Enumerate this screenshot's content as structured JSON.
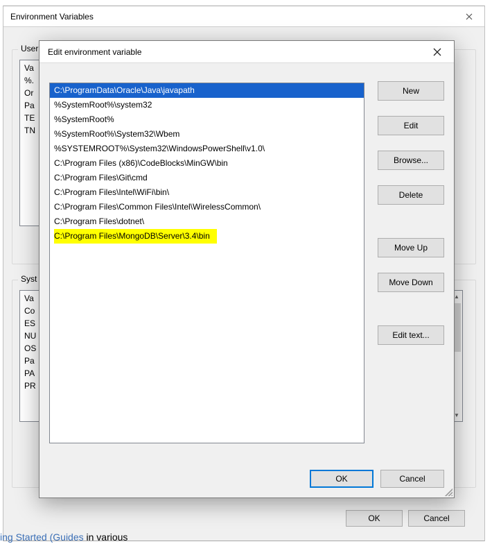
{
  "parent": {
    "title": "Environment Variables",
    "user_label_prefix": "User",
    "system_label_prefix": "Syst",
    "user_vars": [
      "Va",
      "%.",
      "Or",
      "Pa",
      "TE",
      "TN"
    ],
    "system_vars": [
      "Va",
      "Co",
      "ES",
      "NU",
      "OS",
      "Pa",
      "PA",
      "PR"
    ],
    "ok_label": "OK",
    "cancel_label": "Cancel"
  },
  "child": {
    "title": "Edit environment variable",
    "paths": [
      "C:\\ProgramData\\Oracle\\Java\\javapath",
      "%SystemRoot%\\system32",
      "%SystemRoot%",
      "%SystemRoot%\\System32\\Wbem",
      "%SYSTEMROOT%\\System32\\WindowsPowerShell\\v1.0\\",
      "C:\\Program Files (x86)\\CodeBlocks\\MinGW\\bin",
      "C:\\Program Files\\Git\\cmd",
      "C:\\Program Files\\Intel\\WiFi\\bin\\",
      "C:\\Program Files\\Common Files\\Intel\\WirelessCommon\\",
      "C:\\Program Files\\dotnet\\",
      "C:\\Program Files\\MongoDB\\Server\\3.4\\bin"
    ],
    "selected_index": 0,
    "highlighted_index": 10,
    "buttons": {
      "new": "New",
      "edit": "Edit",
      "browse": "Browse...",
      "delete": "Delete",
      "move_up": "Move Up",
      "move_down": "Move Down",
      "edit_text": "Edit text..."
    },
    "ok_label": "OK",
    "cancel_label": "Cancel"
  },
  "fragment": {
    "link": "ing Started (Guides",
    "tail": " in various"
  }
}
